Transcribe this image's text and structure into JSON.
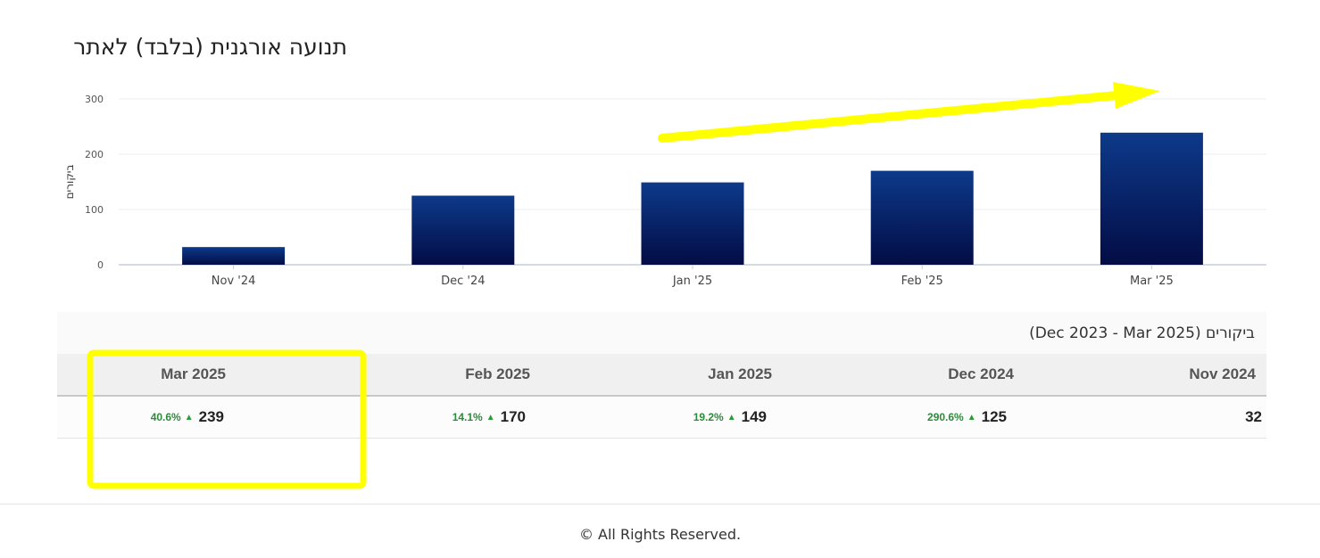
{
  "title": "תנועה אורגנית (בלבד) לאתר",
  "chart_data": {
    "type": "bar",
    "categories": [
      "Nov '24",
      "Dec '24",
      "Jan '25",
      "Feb '25",
      "Mar '25"
    ],
    "values": [
      32,
      125,
      149,
      170,
      239
    ],
    "ylabel": "ביקורים",
    "ylim": [
      0,
      300
    ],
    "yticks": [
      0,
      100,
      200,
      300
    ],
    "grid": true,
    "bar_color": "#0b2a6e"
  },
  "table": {
    "caption": "ביקורים (Dec 2023 - Mar 2025)",
    "columns": [
      {
        "label": "Nov 2024",
        "value": "32",
        "change": ""
      },
      {
        "label": "Dec 2024",
        "value": "125",
        "change": "290.6%"
      },
      {
        "label": "Jan 2025",
        "value": "149",
        "change": "19.2%"
      },
      {
        "label": "Feb 2025",
        "value": "170",
        "change": "14.1%"
      },
      {
        "label": "Mar 2025",
        "value": "239",
        "change": "40.6%"
      }
    ]
  },
  "footer": "© All Rights Reserved.",
  "colors": {
    "highlight": "#ffff00",
    "positive": "#2e8b3a"
  },
  "icons": {
    "change_up": "triangle-up-icon"
  }
}
